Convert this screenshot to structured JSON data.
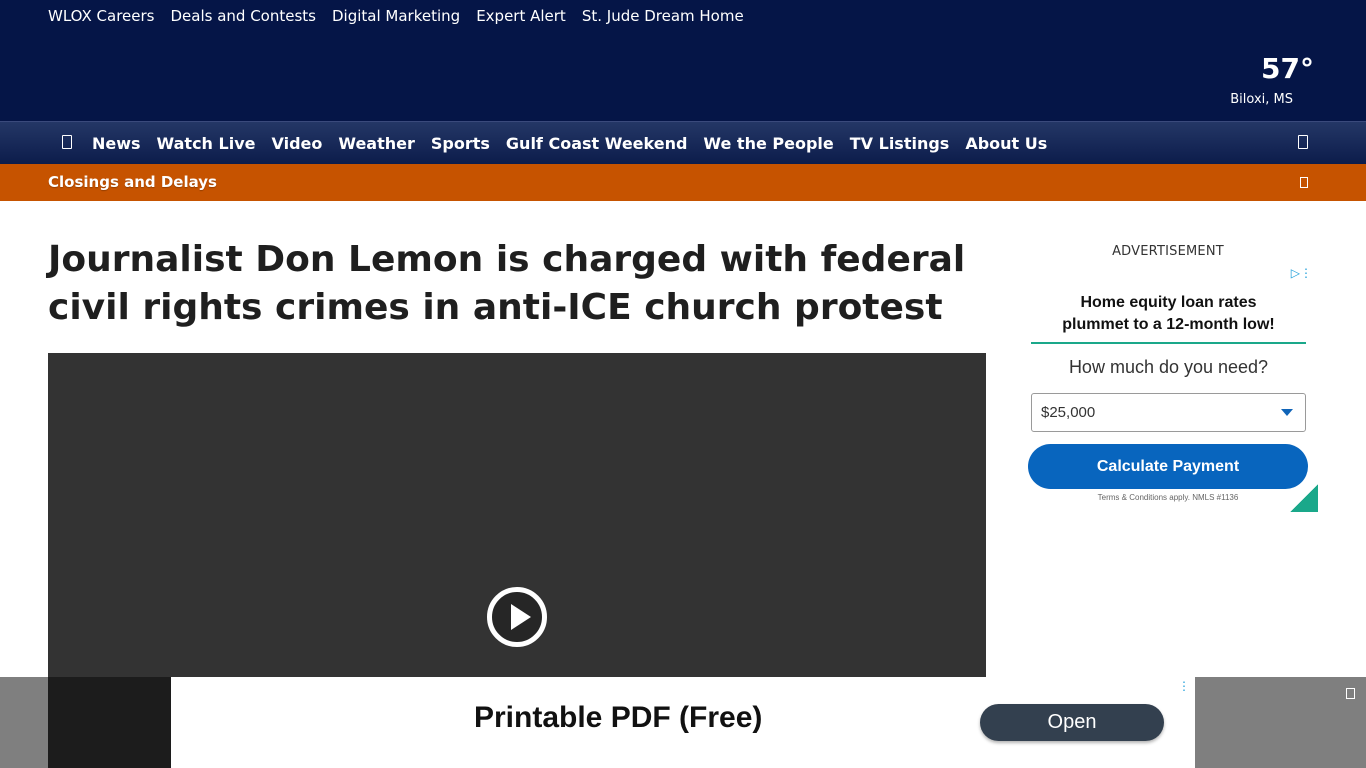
{
  "top_links": [
    "WLOX Careers",
    "Deals and Contests",
    "Digital Marketing",
    "Expert Alert",
    "St. Jude Dream Home"
  ],
  "weather": {
    "temp": "57°",
    "location": "Biloxi, MS"
  },
  "nav": {
    "items": [
      "News",
      "Watch Live",
      "Video",
      "Weather",
      "Sports",
      "Gulf Coast Weekend",
      "We the People",
      "TV Listings",
      "About Us"
    ],
    "menu_icon": "hamburger-icon",
    "search_icon": "search-icon"
  },
  "alert": {
    "text": "Closings and Delays",
    "close_icon": "close-icon"
  },
  "article": {
    "headline": "Journalist Don Lemon is charged with federal civil rights crimes in anti-ICE church protest"
  },
  "video": {
    "play_icon": "play-icon"
  },
  "side_ad": {
    "label": "ADVERTISEMENT",
    "headline_line1": "Home equity loan rates",
    "headline_line2": "plummet to a 12-month low!",
    "question": "How much do you need?",
    "amount": "$25,000",
    "button": "Calculate Payment",
    "terms": "Terms & Conditions apply. NMLS #1136"
  },
  "bottom_ad": {
    "title": "Printable PDF (Free)",
    "button": "Open"
  },
  "colors": {
    "header_bg": "#051547",
    "nav_bg": "#182a5c",
    "alert_bg": "#c65300",
    "video_bg": "#333333",
    "ad_button": "#0865be",
    "ad_accent": "#1aa88a"
  }
}
